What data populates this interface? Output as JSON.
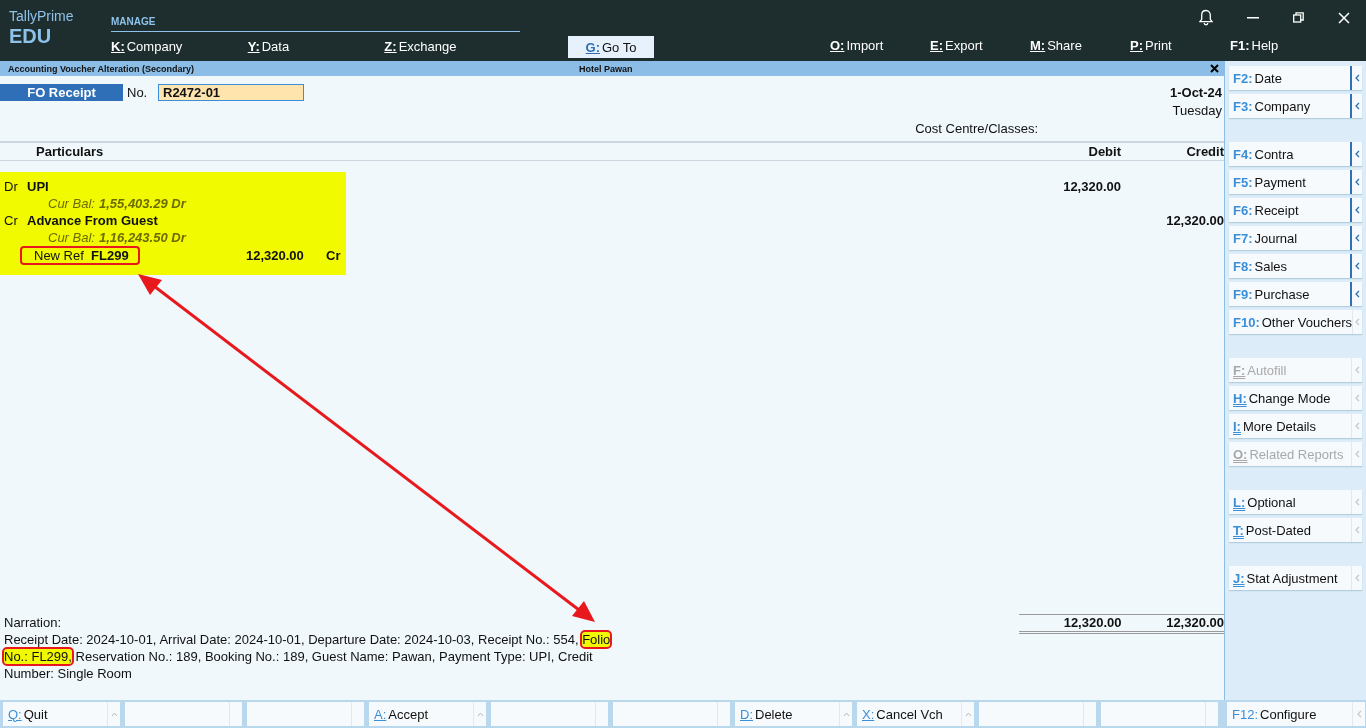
{
  "app": {
    "name": "TallyPrime",
    "edition": "EDU"
  },
  "menu": {
    "section": "MANAGE",
    "manage_items": [
      {
        "key": "K:",
        "label": "Company",
        "underlined": true
      },
      {
        "key": "Y:",
        "label": "Data",
        "underlined": true
      },
      {
        "key": "Z:",
        "label": "Exchange",
        "underlined": true
      }
    ],
    "goto": {
      "key": "G:",
      "label": "Go To",
      "selected": true
    },
    "right_items": [
      {
        "key": "O:",
        "label": "Import",
        "underlined": true
      },
      {
        "key": "E:",
        "label": "Export",
        "underlined": true
      },
      {
        "key": "M:",
        "label": "Share",
        "underlined": true
      },
      {
        "key": "P:",
        "label": "Print",
        "underlined": true
      },
      {
        "key": "F1:",
        "label": "Help",
        "underlined": false
      }
    ]
  },
  "title_bar": {
    "screen": "Accounting Voucher Alteration (Secondary)",
    "company": "Hotel Pawan"
  },
  "voucher": {
    "type": "FO Receipt",
    "no_label": "No.",
    "number": "R2472-01",
    "date": "1-Oct-24",
    "day": "Tuesday",
    "cost_centre_label": "Cost Centre/Classes:",
    "columns": [
      "Particulars",
      "Debit",
      "Credit"
    ],
    "highlighted": true,
    "entries": [
      {
        "side": "Dr",
        "ledger": "UPI",
        "balance_label": "Cur Bal:",
        "balance": "1,55,403.29 Dr",
        "debit": "12,320.00"
      },
      {
        "side": "Cr",
        "ledger": "Advance From Guest",
        "balance_label": "Cur Bal:",
        "balance": "1,16,243.50 Dr",
        "credit": "12,320.00",
        "bill": {
          "type": "New Ref",
          "name": "FL299",
          "amount": "12,320.00",
          "side": "Cr",
          "highlighted": true
        }
      }
    ],
    "narration_label": "Narration:",
    "narration": [
      {
        "text": "Receipt Date: 2024-10-01, Arrival Date: 2024-10-01, Departure Date: 2024-10-03, Receipt No.: 554, ",
        "highlighted": false
      },
      {
        "text": "Folio No.: FL299,",
        "highlighted": true
      },
      {
        "text": " Reservation No.: 189, Booking No.: 189, Guest Name: Pawan, Payment Type: UPI, Credit Number: Single Room",
        "highlighted": false
      }
    ],
    "total_debit": "12,320.00",
    "total_credit": "12,320.00"
  },
  "annotation_arrow": true,
  "sidebar": {
    "groups": [
      [
        {
          "key": "F2:",
          "label": "Date",
          "underlined": false,
          "disabled": false,
          "expandable": true
        },
        {
          "key": "F3:",
          "label": "Company",
          "underlined": false,
          "disabled": false,
          "expandable": true
        }
      ],
      [
        {
          "key": "F4:",
          "label": "Contra",
          "underlined": false,
          "disabled": false,
          "expandable": true
        },
        {
          "key": "F5:",
          "label": "Payment",
          "underlined": false,
          "disabled": false,
          "expandable": true
        },
        {
          "key": "F6:",
          "label": "Receipt",
          "underlined": false,
          "disabled": false,
          "expandable": true
        },
        {
          "key": "F7:",
          "label": "Journal",
          "underlined": false,
          "disabled": false,
          "expandable": true
        },
        {
          "key": "F8:",
          "label": "Sales",
          "underlined": false,
          "disabled": false,
          "expandable": true
        },
        {
          "key": "F9:",
          "label": "Purchase",
          "underlined": false,
          "disabled": false,
          "expandable": true
        },
        {
          "key": "F10:",
          "label": "Other Vouchers",
          "underlined": false,
          "disabled": false,
          "expandable": false
        }
      ],
      [
        {
          "key": "F:",
          "label": "Autofill",
          "underlined": true,
          "disabled": true,
          "expandable": false
        },
        {
          "key": "H:",
          "label": "Change Mode",
          "underlined": true,
          "disabled": false,
          "expandable": false
        },
        {
          "key": "I:",
          "label": "More Details",
          "underlined": true,
          "disabled": false,
          "expandable": false
        },
        {
          "key": "O:",
          "label": "Related Reports",
          "underlined": true,
          "disabled": true,
          "expandable": false
        }
      ],
      [
        {
          "key": "L:",
          "label": "Optional",
          "underlined": true,
          "disabled": false,
          "expandable": false
        },
        {
          "key": "T:",
          "label": "Post-Dated",
          "underlined": true,
          "disabled": false,
          "expandable": false
        }
      ],
      [
        {
          "key": "J:",
          "label": "Stat Adjustment",
          "underlined": true,
          "disabled": false,
          "expandable": false
        }
      ]
    ],
    "configure": {
      "key": "F12:",
      "label": "Configure"
    }
  },
  "bottom_bar": [
    {
      "kind": "key",
      "key": "Q:",
      "label": "Quit"
    },
    {
      "kind": "blank"
    },
    {
      "kind": "blank"
    },
    {
      "kind": "key",
      "key": "A:",
      "label": "Accept"
    },
    {
      "kind": "blank"
    },
    {
      "kind": "blank"
    },
    {
      "kind": "key",
      "key": "D:",
      "label": "Delete"
    },
    {
      "kind": "key",
      "key": "X:",
      "label": "Cancel Vch"
    },
    {
      "kind": "blank"
    },
    {
      "kind": "blank"
    }
  ]
}
